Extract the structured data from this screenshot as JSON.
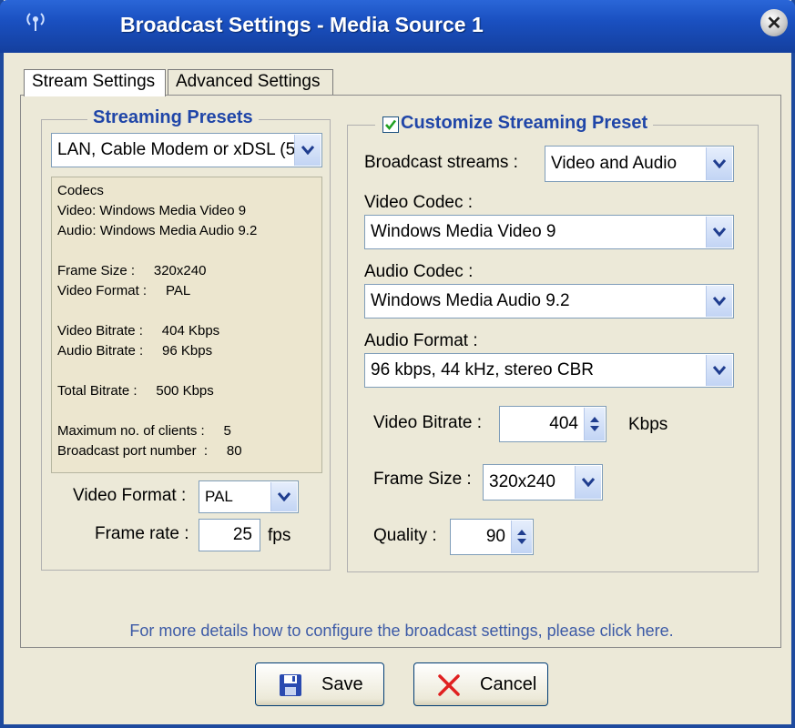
{
  "window": {
    "title": "Broadcast Settings - Media Source 1",
    "close_glyph": "✕"
  },
  "tabs": [
    {
      "label": "Stream Settings",
      "active": true
    },
    {
      "label": "Advanced Settings",
      "active": false
    }
  ],
  "presets": {
    "group_title": "Streaming Presets",
    "selected": "LAN, Cable Modem or xDSL (5",
    "info_lines": [
      "Codecs",
      "Video: Windows Media Video 9",
      "Audio: Windows Media Audio 9.2",
      "",
      "Frame Size :     320x240",
      "Video Format :     PAL",
      "",
      "Video Bitrate :     404 Kbps",
      "Audio Bitrate :     96 Kbps",
      "",
      "Total Bitrate :     500 Kbps",
      "",
      "Maximum no. of clients :     5",
      "Broadcast port number  :     80"
    ],
    "video_format_label": "Video Format :",
    "video_format_value": "PAL",
    "frame_rate_label": "Frame rate :",
    "frame_rate_value": "25",
    "frame_rate_unit": "fps"
  },
  "custom": {
    "group_title": "Customize Streaming Preset",
    "checked": true,
    "broadcast_streams_label": "Broadcast streams :",
    "broadcast_streams_value": "Video and Audio",
    "video_codec_label": "Video Codec :",
    "video_codec_value": "Windows Media Video 9",
    "audio_codec_label": "Audio Codec :",
    "audio_codec_value": "Windows Media Audio 9.2",
    "audio_format_label": "Audio Format :",
    "audio_format_value": "96 kbps, 44 kHz, stereo CBR",
    "video_bitrate_label": "Video Bitrate :",
    "video_bitrate_value": "404",
    "video_bitrate_unit": "Kbps",
    "frame_size_label": "Frame Size :",
    "frame_size_value": "320x240",
    "quality_label": "Quality :",
    "quality_value": "90"
  },
  "help_link": "For more details how to configure the broadcast settings, please click here.",
  "buttons": {
    "save": "Save",
    "cancel": "Cancel"
  },
  "colors": {
    "title_bar": "#1a50c0",
    "group_title": "#2046a8",
    "link": "#3c5aa6",
    "cancel_x": "#e02020",
    "save_icon": "#2a4ab0"
  }
}
